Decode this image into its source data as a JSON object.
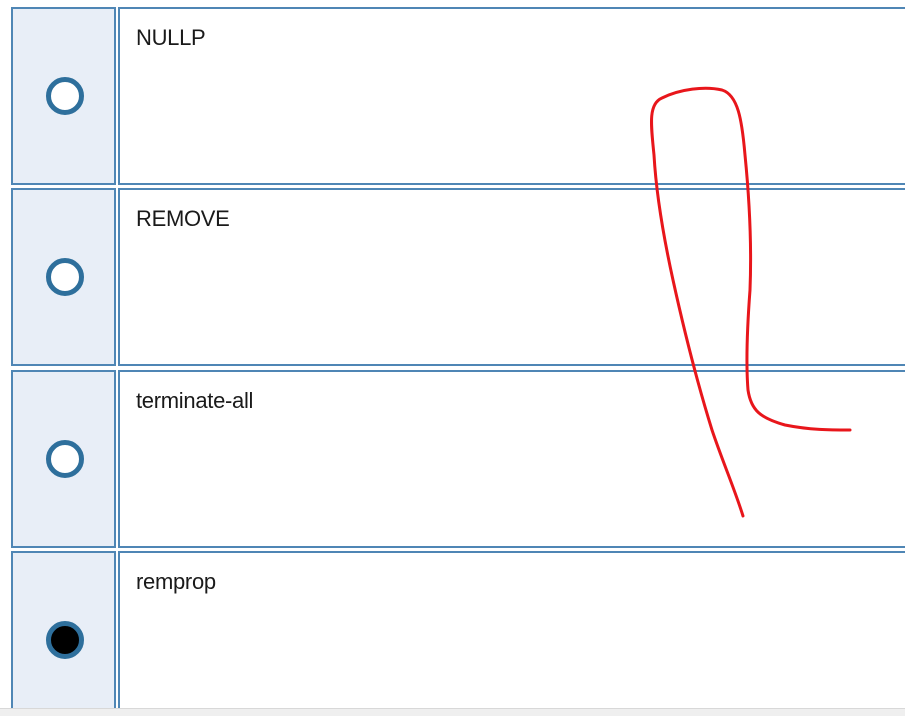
{
  "question": {
    "options": [
      {
        "label": "NULLP",
        "selected": false
      },
      {
        "label": "REMOVE",
        "selected": false
      },
      {
        "label": "terminate-all",
        "selected": false
      },
      {
        "label": "remprop",
        "selected": true
      }
    ]
  },
  "colors": {
    "cell_border": "#4f86b5",
    "radio_cell_background": "#e8eef7",
    "radio_ring": "#2e6f9c",
    "annotation_stroke": "#e8161b"
  },
  "annotation": {
    "type": "freehand-pen-mark",
    "color": "#e8161b"
  }
}
